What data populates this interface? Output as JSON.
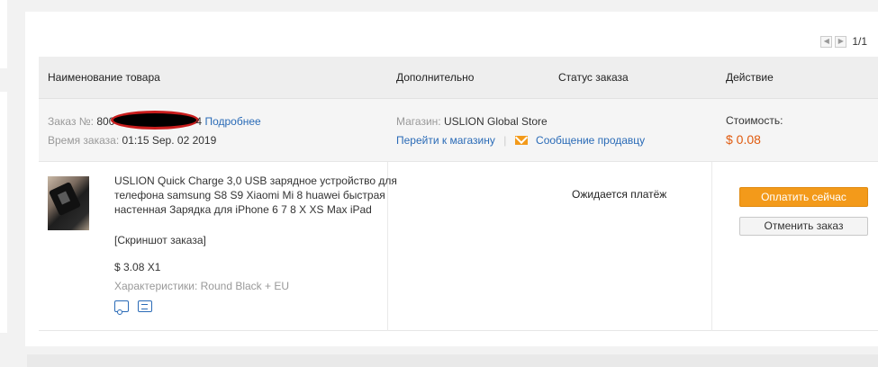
{
  "pager": {
    "prev_icon": "chevron-left-icon",
    "next_icon": "chevron-right-icon",
    "count": "1/1"
  },
  "table_headers": {
    "product": "Наименование товара",
    "additional": "Дополнительно",
    "status": "Статус заказа",
    "action": "Действие"
  },
  "order": {
    "number_label": "Заказ №:",
    "number_prefix": "800",
    "number_suffix": "4",
    "details_link": "Подробнее",
    "time_label": "Время заказа:",
    "time_value": "01:15 Sep. 02 2019",
    "store_label": "Магазин:",
    "store_name": "USLION Global Store",
    "goto_store": "Перейти к магазину",
    "message_seller": "Сообщение продавцу",
    "cost_label": "Стоимость:",
    "cost_value": "$ 0.08"
  },
  "product": {
    "title": "USLION Quick Charge 3,0 USB зарядное устройство для телефона samsung S8 S9 Xiaomi Mi 8 huawei быстрая настенная Зарядка для iPhone 6 7 8 X XS Max iPad",
    "snapshot": "[Скриншот заказа]",
    "price_qty": "$ 3.08 X1",
    "attributes": "Характеристики: Round Black + EU"
  },
  "status_text": "Ожидается платёж",
  "actions": {
    "pay": "Оплатить сейчас",
    "cancel": "Отменить заказ"
  },
  "colors": {
    "accent": "#f39a1a",
    "link": "#2a6bb7",
    "price": "#e05a0e"
  }
}
